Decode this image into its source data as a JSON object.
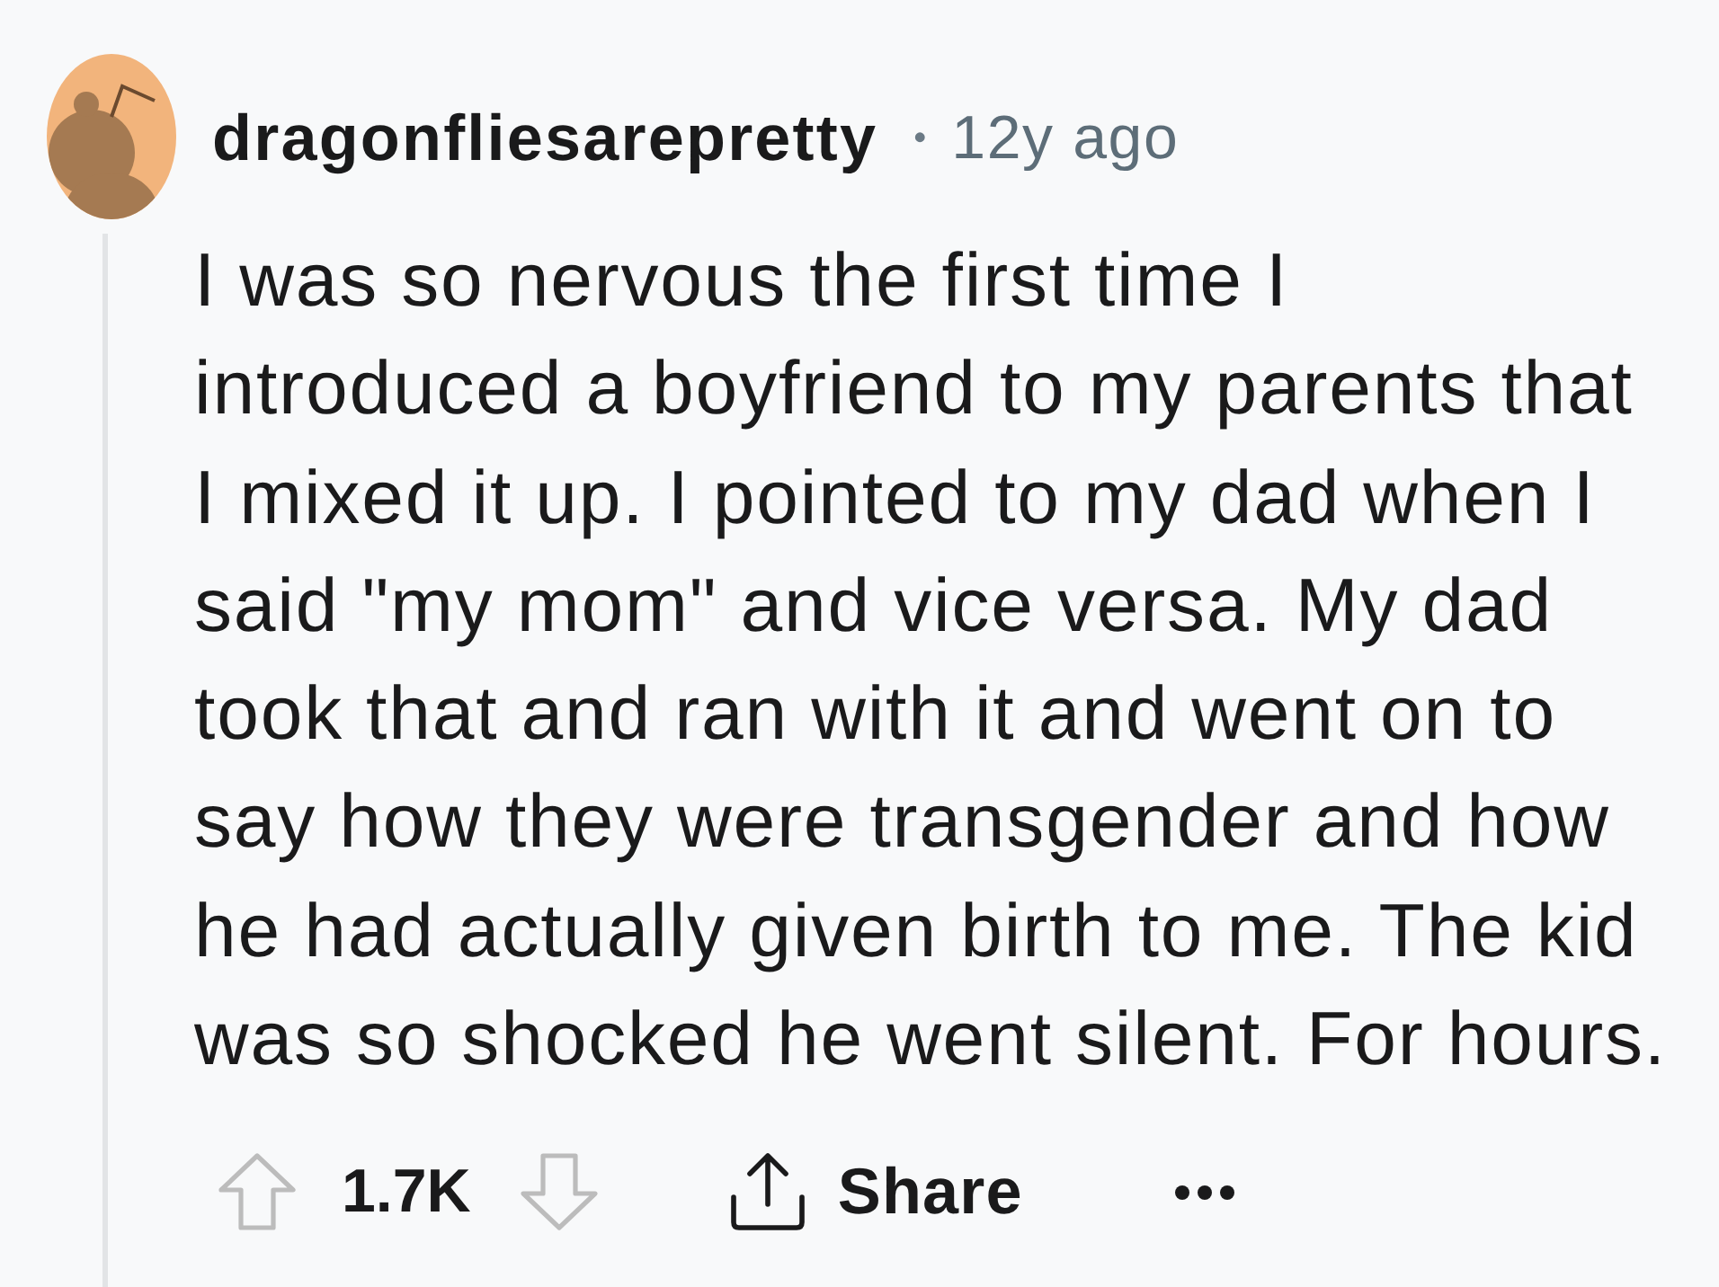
{
  "comment": {
    "author": "dragonfliesarepretty",
    "separator": "•",
    "age": "12y ago",
    "body_lines": [
      "I was so nervous the first time I",
      "introduced a boyfriend to my parents that",
      "I mixed it up. I pointed to my dad when I",
      "said \"my mom\" and vice versa. My dad",
      "took that and ran with it and went on to",
      "say how they were transgender and how",
      "he had actually given birth to me. The kid",
      "was so shocked he went silent. For hours."
    ]
  },
  "actions": {
    "score": "1.7K",
    "share": "Share"
  }
}
